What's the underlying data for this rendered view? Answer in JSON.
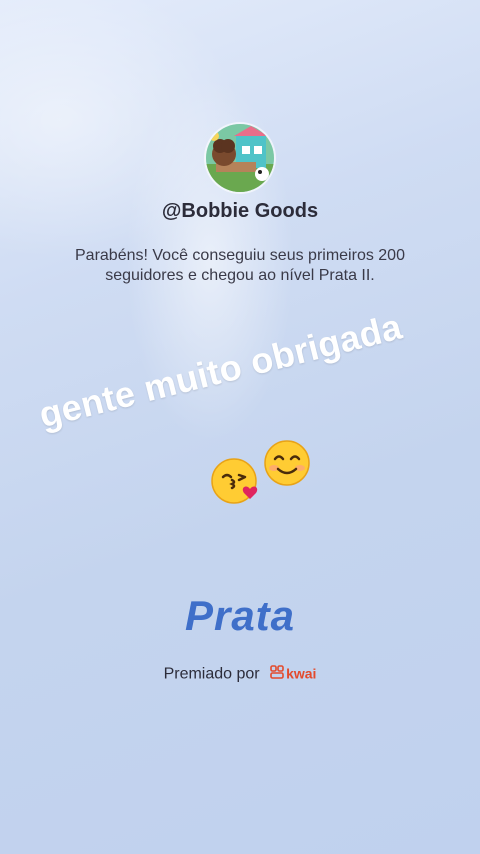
{
  "profile": {
    "username": "@Bobbie Goods",
    "message": "Parabéns! Você conseguiu seus primeiros 200 seguidores e chegou ao nível Prata II."
  },
  "overlay": {
    "text": "gente muito obrigada",
    "emojis": [
      "kissing-face-icon",
      "smiling-face-icon"
    ]
  },
  "level": {
    "name": "Prata"
  },
  "footer": {
    "awarded_by": "Premiado por",
    "brand": "kwai"
  },
  "colors": {
    "level_text": "#3f6fc9",
    "brand": "#e34a2c",
    "background": "#c9d8f1"
  }
}
